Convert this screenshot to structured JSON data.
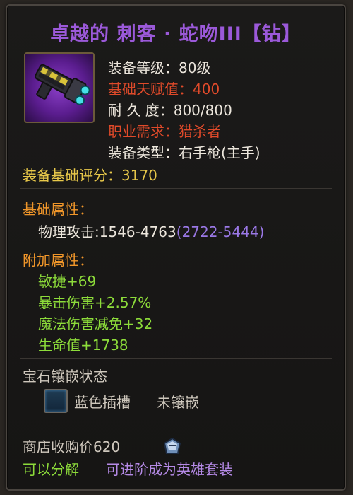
{
  "item": {
    "title": "卓越的 刺客 · 蛇吻III【钻】",
    "icon": "gun-icon"
  },
  "stats": {
    "level_label": "装备等级：80级",
    "talent_label": "基础天赋值：",
    "talent_value": "400",
    "durability_label": "耐 久 度：800/800",
    "class_label": "职业需求：",
    "class_value": "猎杀者",
    "type_label": "装备类型：",
    "type_value": "右手枪(主手)"
  },
  "score": {
    "label": "装备基础评分：",
    "value": "3170"
  },
  "base_attributes": {
    "heading": "基础属性：",
    "attack_label": "物理攻击:1546-4763",
    "attack_range": "(2722-5444)"
  },
  "extra_attributes": {
    "heading": "附加属性：",
    "items": [
      "敏捷+69",
      "暴击伤害+2.57%",
      "魔法伤害减免+32",
      "生命值+1738"
    ]
  },
  "gems": {
    "heading": "宝石镶嵌状态",
    "slot_label": "蓝色插槽",
    "slot_status": "未镶嵌"
  },
  "footer": {
    "sell_price": "商店收购价620",
    "currency_icon": "silver-coin-icon",
    "dismantle": "可以分解",
    "upgrade": "可进阶成为英雄套装"
  },
  "colors": {
    "title": "#9b59d9",
    "red": "#e04a2a",
    "yellow": "#e8c84a",
    "orange": "#f0962a",
    "green": "#8ddc3a",
    "purple": "#9a78e6"
  }
}
